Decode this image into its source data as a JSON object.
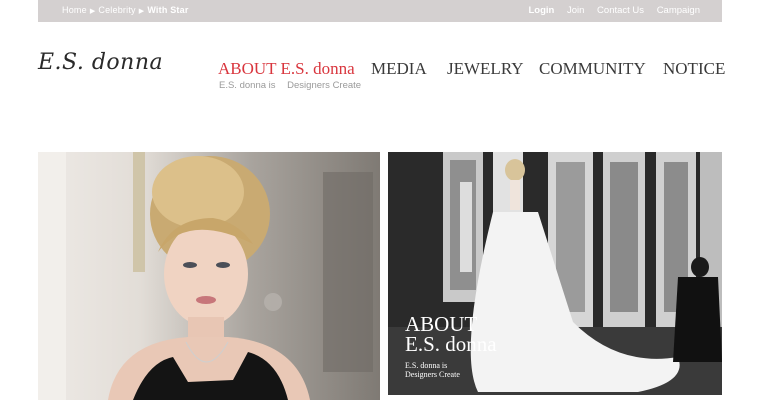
{
  "breadcrumb": {
    "home": "Home",
    "celebrity": "Celebrity",
    "current": "With Star",
    "separator": "▶"
  },
  "utility_nav": {
    "login": "Login",
    "join": "Join",
    "contact": "Contact Us",
    "campaign": "Campaign"
  },
  "logo": {
    "text": "E.S. donna"
  },
  "nav": {
    "about": "ABOUT E.S. donna",
    "media": "MEDIA",
    "jewelry": "JEWELRY",
    "community": "COMMUNITY",
    "notice": "NOTICE"
  },
  "subnav": {
    "item1": "E.S. donna is",
    "item2": "Designers Create"
  },
  "feature": {
    "title_line1": "ABOUT",
    "title_line2": "E.S. donna",
    "sub_line1": "E.S. donna is",
    "sub_line2": "Designers Create"
  },
  "colors": {
    "accent": "#d9363e",
    "topbar": "#d4d0d0"
  }
}
